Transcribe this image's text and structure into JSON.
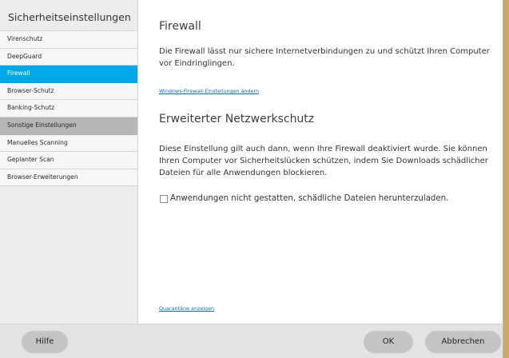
{
  "sidebar": {
    "title": "Sicherheitseinstellungen",
    "items": [
      {
        "label": "Virenschutz",
        "state": "normal"
      },
      {
        "label": "DeepGuard",
        "state": "normal"
      },
      {
        "label": "Firewall",
        "state": "selected"
      },
      {
        "label": "Browser-Schutz",
        "state": "normal"
      },
      {
        "label": "Banking-Schutz",
        "state": "normal"
      },
      {
        "label": "Sonstige Einstellungen",
        "state": "section"
      },
      {
        "label": "Manuelles Scanning",
        "state": "normal"
      },
      {
        "label": "Geplanter Scan",
        "state": "normal"
      },
      {
        "label": "Browser-Erweiterungen",
        "state": "normal"
      }
    ]
  },
  "main": {
    "title": "Firewall",
    "description": "Die Firewall lässt nur sichere Internetverbindungen zu und schützt Ihren Computer vor Eindringlingen.",
    "windows_firewall_link": "Windows-Firewall-Einstellungen ändern",
    "advanced_title": "Erweiterter Netzwerkschutz",
    "advanced_description": "Diese Einstellung gilt auch dann, wenn Ihre Firewall deaktiviert wurde. Sie können Ihren Computer vor Sicherheitslücken schützen, indem Sie Downloads schädlicher Dateien für alle Anwendungen blockieren.",
    "checkbox_label": "Anwendungen nicht gestatten, schädliche Dateien herunterzuladen.",
    "checkbox_checked": false,
    "quarantine_link": "Quarantäne anzeigen"
  },
  "footer": {
    "help_label": "Hilfe",
    "ok_label": "OK",
    "cancel_label": "Abbrechen"
  },
  "colors": {
    "accent": "#00a8e8",
    "section_header": "#b6b6b6",
    "link": "#0c6fbf",
    "outer_background": "#c9a86b"
  }
}
